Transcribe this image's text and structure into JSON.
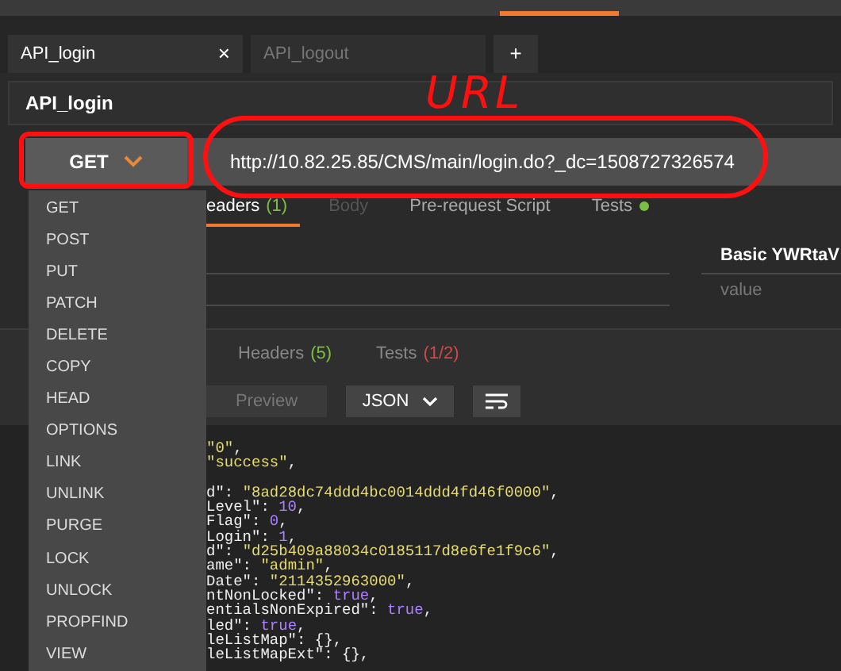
{
  "top_bar": {
    "active": true
  },
  "window_tabs": [
    {
      "label": "API_login",
      "selected": true,
      "close": "×"
    },
    {
      "label": "API_logout",
      "selected": false
    }
  ],
  "new_tab": "+",
  "request_name": "API_login",
  "method": {
    "label": "GET",
    "expanded": true
  },
  "url": "http://10.82.25.85/CMS/main/login.do?_dc=1508727326574",
  "request_tabs": [
    {
      "label": "eaders",
      "count": "(1)",
      "selected": true,
      "dimmed": false,
      "indicator": false
    },
    {
      "label": "Body",
      "selected": false,
      "dimmed": true,
      "indicator": false
    },
    {
      "label": "Pre-request Script",
      "selected": false,
      "dimmed": false,
      "indicator": false
    },
    {
      "label": "Tests",
      "selected": false,
      "dimmed": false,
      "indicator": true
    }
  ],
  "headers_table": {
    "value": "Basic YWRtaV",
    "value_placeholder": "value"
  },
  "response_tabs": [
    {
      "label": "Headers",
      "count": "(5)",
      "failed": false
    },
    {
      "label": "Tests",
      "count": "(1/2)",
      "failed": true
    }
  ],
  "response_toolbar": {
    "preview": "Preview",
    "format": "JSON"
  },
  "code_lines": [
    {
      "kind": "code",
      "text": "\"0\","
    },
    {
      "kind": "code",
      "text": "\"success\","
    },
    {
      "kind": "blank"
    },
    {
      "kind": "code",
      "text": "d\": \"8ad28dc74ddd4bc0014ddd4fd46f0000\","
    },
    {
      "kind": "code",
      "text": "Level\": 10,"
    },
    {
      "kind": "code",
      "text": "Flag\": 0,"
    },
    {
      "kind": "code",
      "text": "Login\": 1,"
    },
    {
      "kind": "code",
      "text": "d\": \"d25b409a88034c0185117d8e6fe1f9c6\","
    },
    {
      "kind": "code",
      "text": "ame\": \"admin\","
    },
    {
      "kind": "code",
      "text": "Date\": \"2114352963000\","
    },
    {
      "kind": "code",
      "text": "ntNonLocked\": true,"
    },
    {
      "kind": "code",
      "text": "entialsNonExpired\": true,"
    },
    {
      "kind": "code",
      "text": "led\": true,"
    },
    {
      "kind": "code",
      "text": "leListMap\": {},"
    },
    {
      "kind": "code",
      "text": "leListMapExt\": {},"
    }
  ],
  "method_menu": [
    "GET",
    "POST",
    "PUT",
    "PATCH",
    "DELETE",
    "COPY",
    "HEAD",
    "OPTIONS",
    "LINK",
    "UNLINK",
    "PURGE",
    "LOCK",
    "UNLOCK",
    "PROPFIND",
    "VIEW"
  ],
  "annotation": {
    "label": "URL"
  }
}
